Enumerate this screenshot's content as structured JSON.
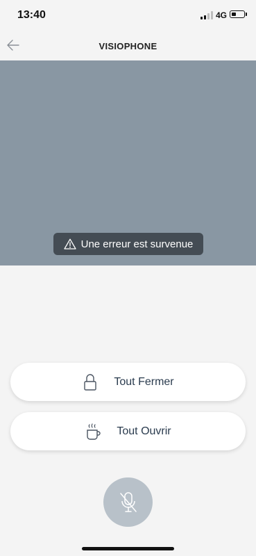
{
  "status": {
    "time": "13:40",
    "network": "4G",
    "signal_bars": 2,
    "signal_max": 4,
    "battery_level": 0.4
  },
  "header": {
    "title": "VISIOPHONE",
    "back_icon": "arrow-left-icon"
  },
  "video": {
    "error_message": "Une erreur est survenue",
    "error_icon": "warning-icon"
  },
  "actions": {
    "close_all": {
      "label": "Tout Fermer",
      "icon": "lock-icon"
    },
    "open_all": {
      "label": "Tout Ouvrir",
      "icon": "hot-drink-icon"
    }
  },
  "mic": {
    "icon": "microphone-muted-icon",
    "state": "muted"
  },
  "colors": {
    "background": "#f4f4f4",
    "video_placeholder": "#8997a3",
    "toast_background": "#444c54",
    "button_text": "#2a3b4e",
    "mic_button": "#b8c1c9"
  }
}
